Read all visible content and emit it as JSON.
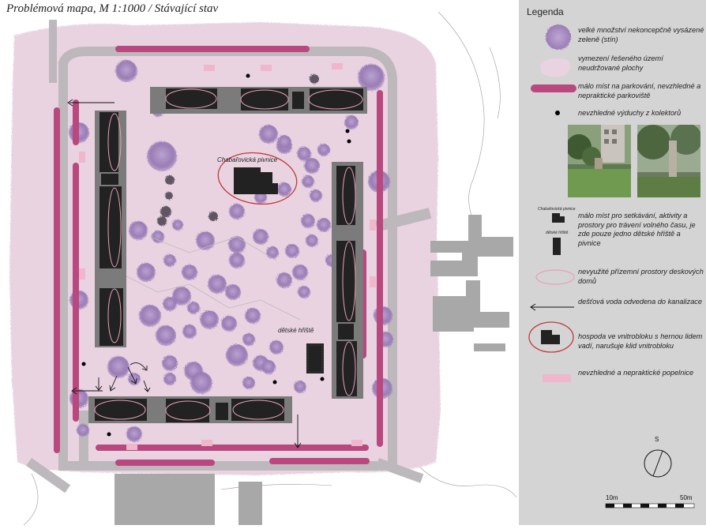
{
  "title": "Problémová mapa, M 1:1000 / Stávající stav",
  "map_labels": {
    "pub": "Chabařovická pivnice",
    "playground": "dětské hřiště"
  },
  "legend": {
    "title": "Legenda",
    "items": [
      {
        "id": "greenery",
        "text": "velké množství nekoncepčně vysázené zeleně (stín)"
      },
      {
        "id": "area",
        "text": "vymezení řešeného území neudržované plochy"
      },
      {
        "id": "parking",
        "text": "málo míst na parkování, nevzhledné a nepraktické parkoviště"
      },
      {
        "id": "vents",
        "text": "nevzhledné výduchy z kolektorů"
      },
      {
        "id": "meeting",
        "text": "málo míst pro setkávání, aktivity a prostory pro trávení volného času, je zde pouze jedno dětské hřiště a pivnice"
      },
      {
        "id": "ground",
        "text": "nevyužité přízemní prostory deskových domů"
      },
      {
        "id": "rain",
        "text": "dešťová voda odvedena do kanalizace"
      },
      {
        "id": "pubitem",
        "text": "hospoda ve vnitrobloku s hernou lidem vadí, narušuje klid vnitrobloku"
      },
      {
        "id": "bins",
        "text": "nevzhledné a nepraktické popelnice"
      }
    ],
    "mini_labels": {
      "pub": "Chabařovická pivnice",
      "playground": "dětské hřiště"
    }
  },
  "north": "S",
  "scale": {
    "start": "10m",
    "end": "50m"
  },
  "colors": {
    "area": "#e9d3e1",
    "road": "#bdb8bb",
    "building": "#222222",
    "parking": "#b8487e",
    "greenery": "#9a7cb6",
    "bins": "#f0b6cb",
    "legend_bg": "#d4d4d4"
  }
}
